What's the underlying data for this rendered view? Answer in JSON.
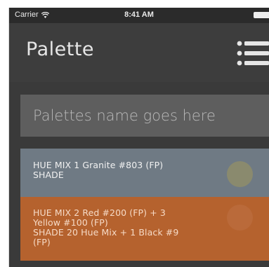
{
  "status_bar": {
    "carrier": "Carrier",
    "time": "8:41 AM"
  },
  "nav": {
    "title": "Palette",
    "menu_icon": "list-menu-icon"
  },
  "name_field": {
    "placeholder": "Palettes name goes here",
    "value": ""
  },
  "palettes": [
    {
      "lines": [
        "HUE MIX  1 Granite #803 (FP)",
        "SHADE"
      ],
      "background": "#6f7a84",
      "swatch_color": "#8a8a6e"
    },
    {
      "lines": [
        "HUE MIX  2 Red #200 (FP) + 3",
        "Yellow #100 (FP)",
        "SHADE  20 Hue Mix + 1 Black #9",
        "(FP)"
      ],
      "background": "#b5622e",
      "swatch_color": "#ba6a3a"
    }
  ],
  "colors": {
    "background": "#3a3a3a",
    "nav_bar": "#3d3d3d",
    "input_background": "#5e5e5e"
  }
}
